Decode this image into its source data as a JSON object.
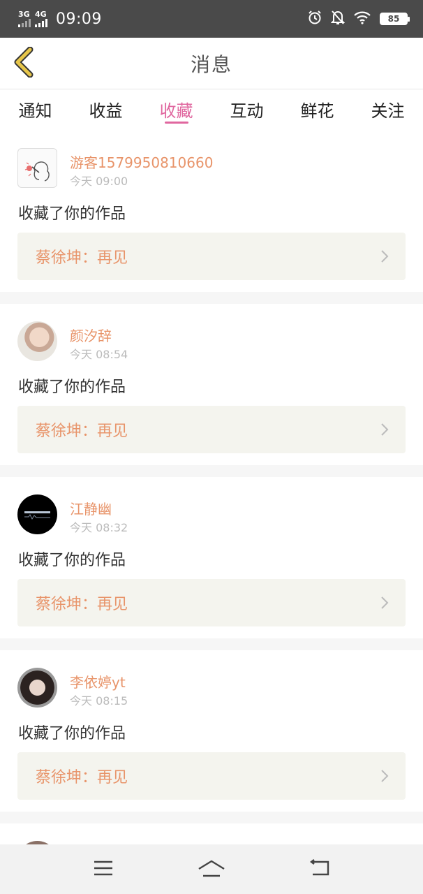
{
  "status_bar": {
    "network_1": "3G",
    "network_2": "4G",
    "time": "09:09",
    "battery": "85"
  },
  "header": {
    "title": "消息"
  },
  "tabs": [
    {
      "label": "通知"
    },
    {
      "label": "收益"
    },
    {
      "label": "收藏",
      "active": true
    },
    {
      "label": "互动"
    },
    {
      "label": "鲜花"
    },
    {
      "label": "关注"
    }
  ],
  "feed": [
    {
      "user": "游客1579950810660",
      "time": "今天 09:00",
      "action": "收藏了你的作品",
      "work": "蔡徐坤：再见"
    },
    {
      "user": "颜汐辞",
      "time": "今天 08:54",
      "action": "收藏了你的作品",
      "work": "蔡徐坤：再见"
    },
    {
      "user": "江静幽",
      "time": "今天 08:32",
      "action": "收藏了你的作品",
      "work": "蔡徐坤：再见"
    },
    {
      "user": "李依婷yt",
      "time": "今天 08:15",
      "action": "收藏了你的作品",
      "work": "蔡徐坤：再见"
    }
  ],
  "colors": {
    "accent": "#e0679f",
    "username": "#e8946a",
    "work_box_bg": "#f4f4ee",
    "back_arrow": "#e7c64a"
  },
  "icons": {
    "back": "chevron-left-icon",
    "nav": [
      "menu-icon",
      "home-icon",
      "back-icon"
    ]
  }
}
